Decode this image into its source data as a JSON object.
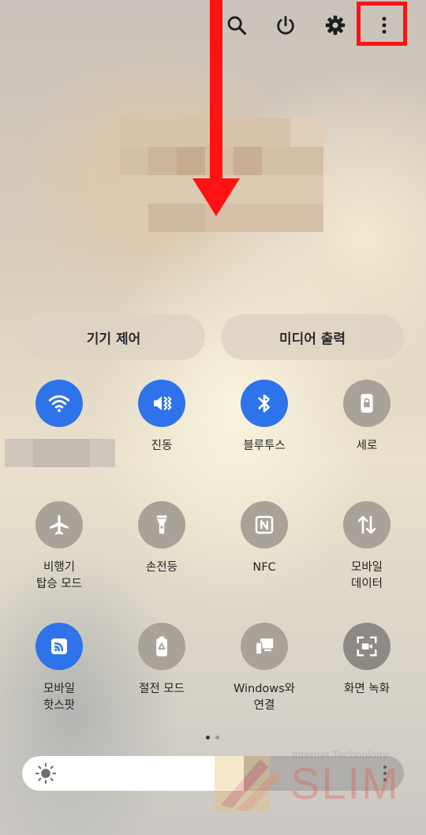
{
  "header": {
    "icons": [
      {
        "name": "search-icon"
      },
      {
        "name": "power-icon"
      },
      {
        "name": "settings-icon"
      },
      {
        "name": "more-options-icon"
      }
    ]
  },
  "panel_buttons": {
    "device_control": "기기 제어",
    "media_output": "미디어 출력"
  },
  "tiles": [
    {
      "label": "",
      "icon": "wifi-icon",
      "state": "on"
    },
    {
      "label": "진동",
      "icon": "vibrate-icon",
      "state": "on"
    },
    {
      "label": "블루투스",
      "icon": "bluetooth-icon",
      "state": "on"
    },
    {
      "label": "세로",
      "icon": "portrait-lock-icon",
      "state": "off"
    },
    {
      "label": "비행기\n탑승 모드",
      "icon": "airplane-icon",
      "state": "off"
    },
    {
      "label": "손전등",
      "icon": "flashlight-icon",
      "state": "off"
    },
    {
      "label": "NFC",
      "icon": "nfc-icon",
      "state": "off"
    },
    {
      "label": "모바일\n데이터",
      "icon": "mobile-data-icon",
      "state": "off"
    },
    {
      "label": "모바일\n핫스팟",
      "icon": "hotspot-icon",
      "state": "on"
    },
    {
      "label": "절전 모드",
      "icon": "power-saving-icon",
      "state": "off"
    },
    {
      "label": "Windows와\n연결",
      "icon": "link-to-windows-icon",
      "state": "off"
    },
    {
      "label": "화면 녹화",
      "icon": "screen-recorder-icon",
      "state": "off"
    }
  ],
  "page_indicator": {
    "current": 1,
    "total": 2
  },
  "brightness": {
    "level": 0.58
  },
  "watermark": {
    "top": "Internet Technology",
    "brand": "SLIM"
  },
  "colors": {
    "accent": "#2f73ea",
    "tile_off": "#a8a299",
    "annotation": "#ff1212"
  }
}
